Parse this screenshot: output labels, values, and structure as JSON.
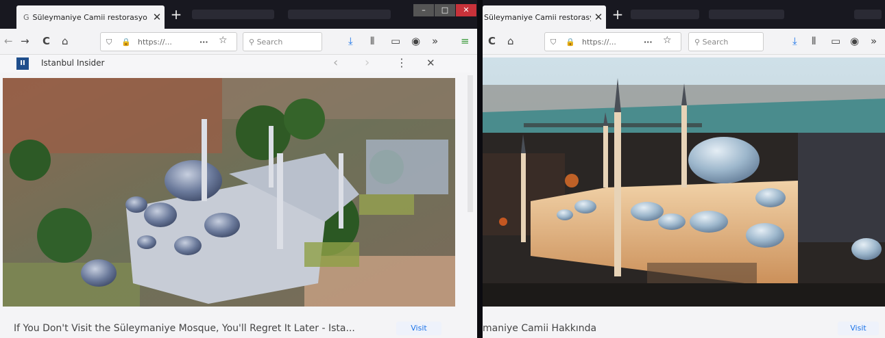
{
  "left": {
    "tab": {
      "title": "Süleymaniye Camii restorasyo"
    },
    "window_controls": [
      "–",
      "□",
      "✕"
    ],
    "url": "https://...",
    "search_placeholder": "Search",
    "info_bar": {
      "site_logo": "II",
      "site_name": "Istanbul Insider"
    },
    "caption": "If You Don't Visit the Süleymaniye Mosque, You'll Regret It Later - Ista...",
    "visit_label": "Visit"
  },
  "right": {
    "tab": {
      "title": "Süleymaniye Camii restorasyo"
    },
    "url": "https://...",
    "search_placeholder": "Search",
    "caption": "maniye Camii Hakkında",
    "visit_label": "Visit"
  },
  "glyphs": {
    "close": "✕",
    "newtab": "+",
    "back": "←",
    "forward": "→",
    "reload": "C",
    "home": "⌂",
    "more": "···",
    "star": "☆",
    "search": "⚲",
    "download": "⤓",
    "library": "⫴",
    "reader": "▭",
    "account": "◉",
    "overflow": "»",
    "menu": "≡",
    "prev": "‹",
    "next": "›",
    "kebab": "⋮",
    "dismiss": "✕"
  },
  "colors": {
    "accent": "#1a73e8",
    "chrome_dark": "#181820",
    "toolbar": "#f3f3f5"
  }
}
